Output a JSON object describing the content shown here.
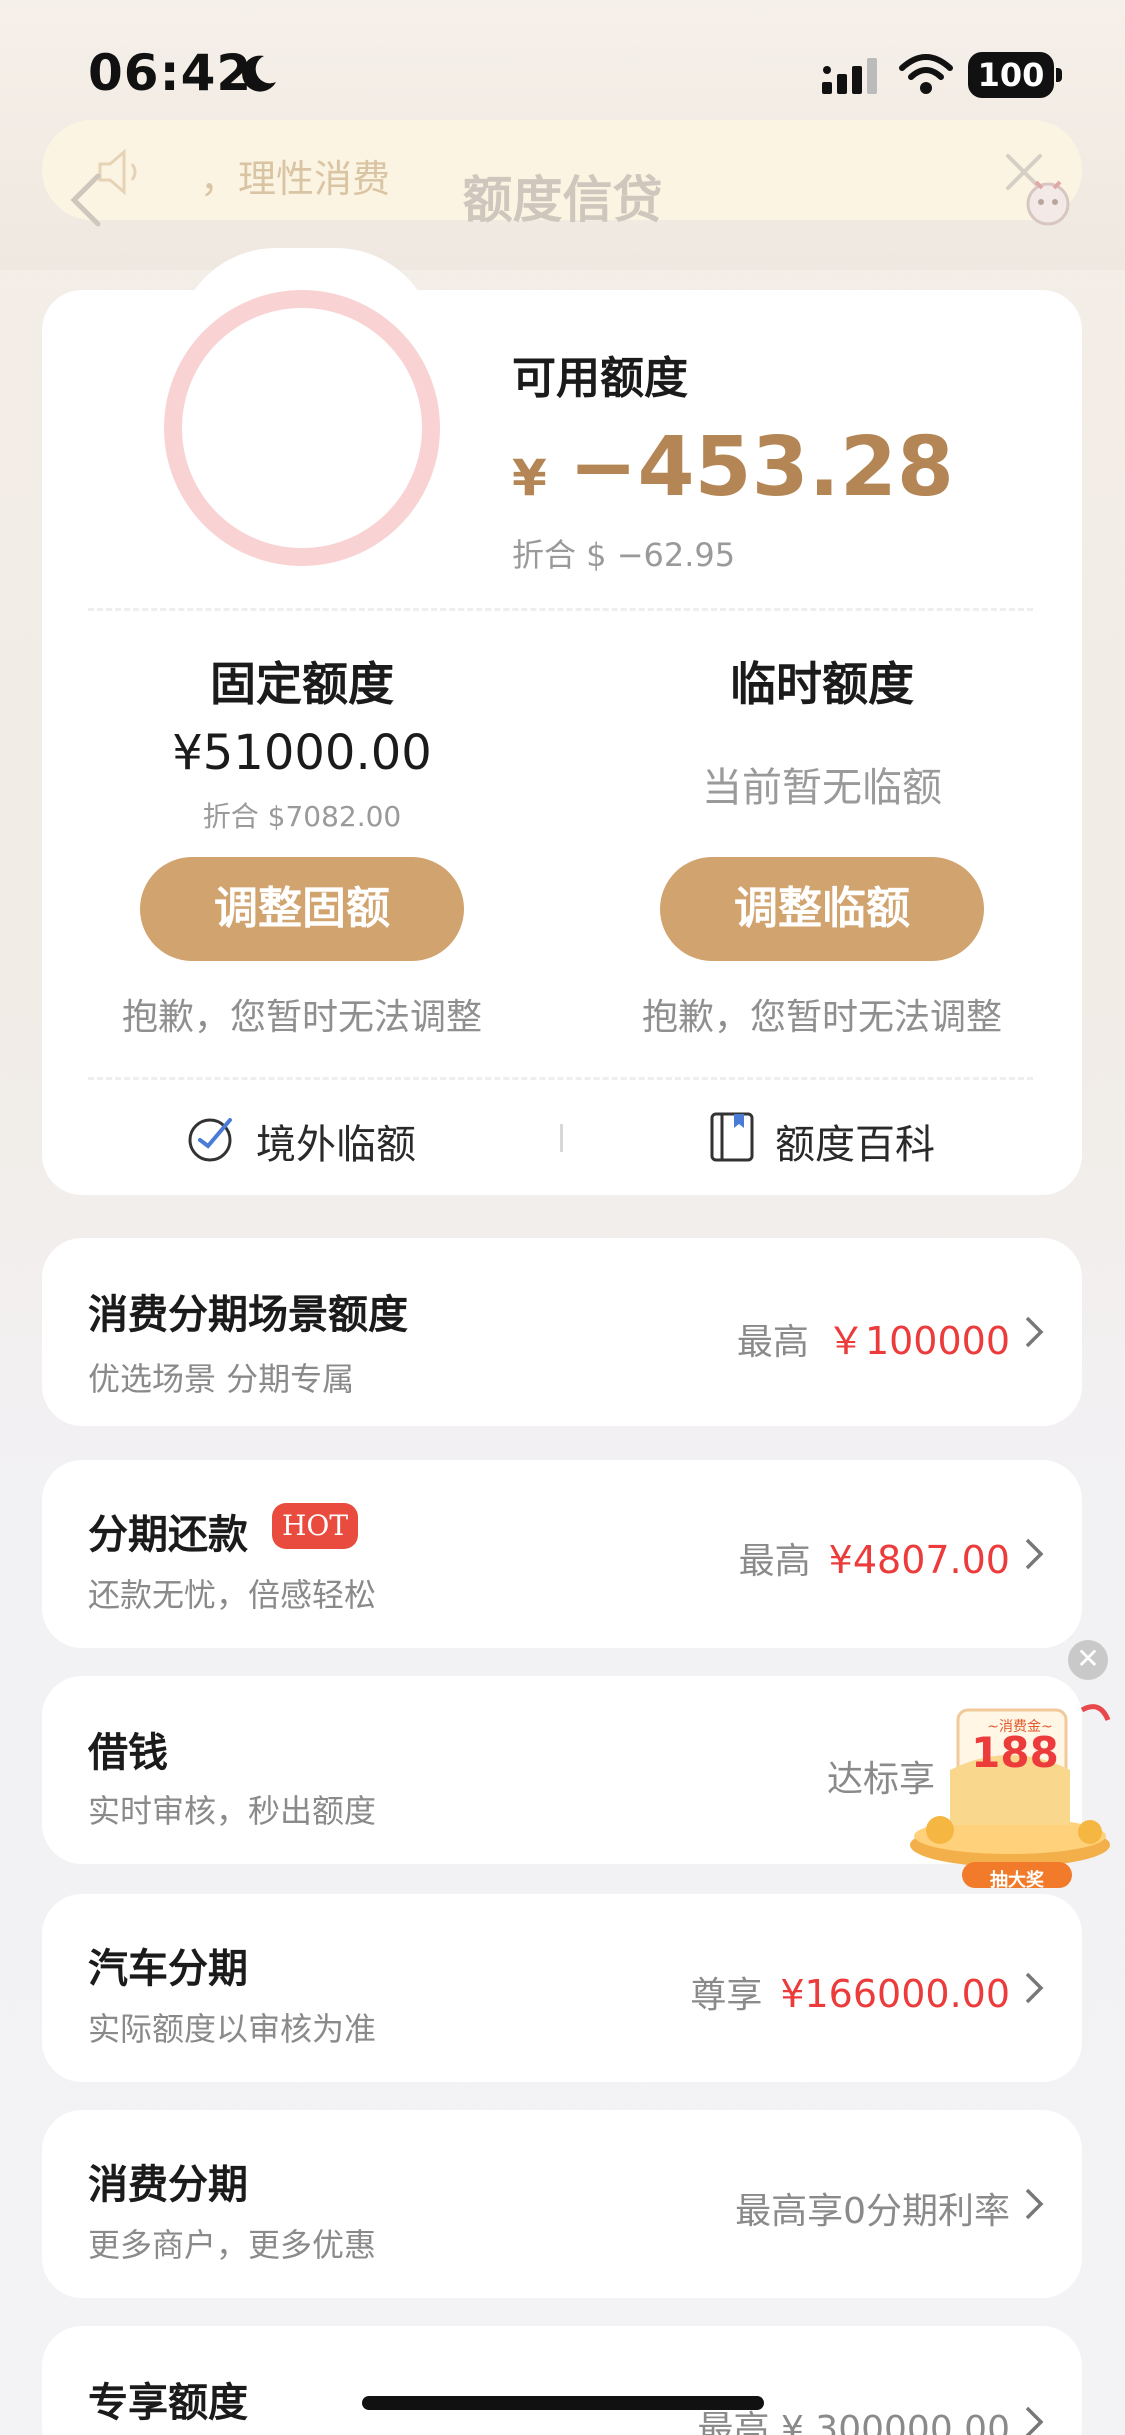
{
  "status_bar": {
    "time": "06:42",
    "battery": "100"
  },
  "header": {
    "title": "额度信贷",
    "notice_text": "，理性消费"
  },
  "summary": {
    "available_label": "可用额度",
    "currency_symbol": "¥",
    "available_amount": "−453.28",
    "available_usd": "折合 $ −62.95"
  },
  "fixed": {
    "title": "固定额度",
    "amount": "¥51000.00",
    "usd": "折合 $7082.00",
    "button": "调整固额",
    "note": "抱歉，您暂时无法调整"
  },
  "temporary": {
    "title": "临时额度",
    "status": "当前暂无临额",
    "button": "调整临额",
    "note": "抱歉，您暂时无法调整"
  },
  "links": {
    "overseas": "境外临额",
    "encyclopedia": "额度百科"
  },
  "rows": [
    {
      "title": "消费分期场景额度",
      "subtitle": "优选场景 分期专属",
      "prefix": "最高",
      "value": "￥100000"
    },
    {
      "title": "分期还款",
      "badge": "HOT",
      "subtitle": "还款无忧，倍感轻松",
      "prefix": "最高",
      "value": "¥4807.00"
    },
    {
      "title": "借钱",
      "subtitle": "实时审核，秒出额度",
      "prefix": "达标享",
      "value": ""
    },
    {
      "title": "汽车分期",
      "subtitle": "实际额度以审核为准",
      "prefix": "尊享",
      "value": "¥166000.00"
    },
    {
      "title": "消费分期",
      "subtitle": "更多商户，更多优惠",
      "prefix": "最高享0分期利率",
      "value": ""
    },
    {
      "title": "专享额度",
      "subtitle": "",
      "prefix": "最高 ¥ 300000.00",
      "value": ""
    }
  ],
  "promo": {
    "top_text": "~消费金~",
    "amount": "188",
    "button": "抽大奖"
  },
  "colors": {
    "accent": "#d1a36f",
    "amount_brown": "#b48655",
    "red": "#ec3b3b",
    "ring": "#f9d3d3"
  }
}
